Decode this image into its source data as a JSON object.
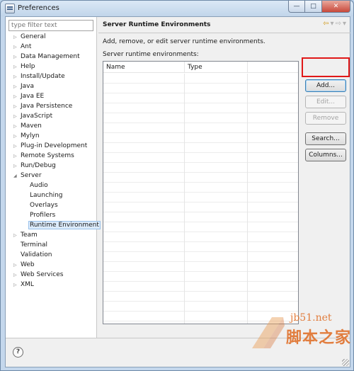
{
  "window": {
    "title": "Preferences",
    "controls": [
      "minimize-icon",
      "maximize-icon",
      "close-icon"
    ]
  },
  "filter": {
    "placeholder": "type filter text"
  },
  "tree": {
    "items": [
      {
        "label": "General",
        "expanded": false
      },
      {
        "label": "Ant",
        "expanded": false
      },
      {
        "label": "Data Management",
        "expanded": false
      },
      {
        "label": "Help",
        "expanded": false
      },
      {
        "label": "Install/Update",
        "expanded": false
      },
      {
        "label": "Java",
        "expanded": false
      },
      {
        "label": "Java EE",
        "expanded": false
      },
      {
        "label": "Java Persistence",
        "expanded": false
      },
      {
        "label": "JavaScript",
        "expanded": false
      },
      {
        "label": "Maven",
        "expanded": false
      },
      {
        "label": "Mylyn",
        "expanded": false
      },
      {
        "label": "Plug-in Development",
        "expanded": false
      },
      {
        "label": "Remote Systems",
        "expanded": false
      },
      {
        "label": "Run/Debug",
        "expanded": false
      },
      {
        "label": "Server",
        "expanded": true,
        "children": [
          "Audio",
          "Launching",
          "Overlays",
          "Profilers",
          "Runtime Environment"
        ]
      },
      {
        "label": "Team",
        "expanded": false
      },
      {
        "label": "Terminal",
        "leaf": true
      },
      {
        "label": "Validation",
        "leaf": true
      },
      {
        "label": "Web",
        "expanded": false
      },
      {
        "label": "Web Services",
        "expanded": false
      },
      {
        "label": "XML",
        "expanded": false
      }
    ],
    "selected": "Runtime Environment"
  },
  "page": {
    "title": "Server Runtime Environments",
    "description": "Add, remove, or edit server runtime environments.",
    "list_label": "Server runtime environments:"
  },
  "table": {
    "columns": [
      "Name",
      "Type"
    ],
    "rows": []
  },
  "buttons": {
    "add": "Add...",
    "edit": "Edit...",
    "remove": "Remove",
    "search": "Search...",
    "columns": "Columns..."
  },
  "watermark": {
    "site": "jb51.net",
    "brand": "脚本之家"
  },
  "colors": {
    "highlight": "#e01818",
    "watermark": "#e06e26"
  }
}
